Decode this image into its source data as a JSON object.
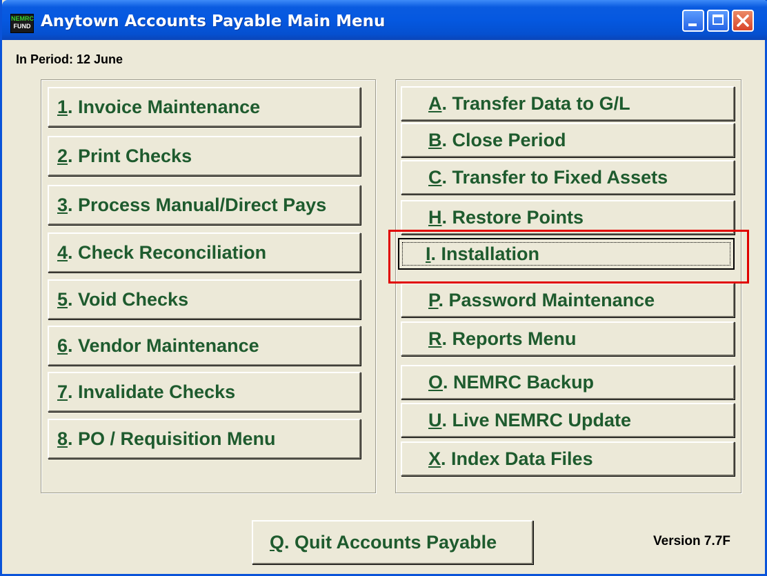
{
  "window": {
    "title": "Anytown Accounts Payable  Main Menu",
    "icon_text_top": "NEMRC",
    "icon_text_bottom": "FUND"
  },
  "period_label": "In Period: 12 June",
  "left_menu": [
    {
      "key": "1",
      "rest": ".  Invoice Maintenance"
    },
    {
      "key": "2",
      "rest": ". Print Checks"
    },
    {
      "key": "3",
      "rest": ". Process Manual/Direct Pays"
    },
    {
      "key": "4",
      "rest": ". Check Reconciliation"
    },
    {
      "key": "5",
      "rest": ". Void Checks"
    },
    {
      "key": "6",
      "rest": ". Vendor Maintenance"
    },
    {
      "key": "7",
      "rest": ". Invalidate Checks"
    },
    {
      "key": "8",
      "rest": ". PO / Requisition Menu"
    }
  ],
  "right_menu": [
    {
      "key": "A",
      "rest": ". Transfer Data to G/L"
    },
    {
      "key": "B",
      "rest": ". Close Period"
    },
    {
      "key": "C",
      "rest": ". Transfer to Fixed Assets"
    },
    {
      "key": "H",
      "rest": ". Restore Points"
    },
    {
      "key": "I",
      "rest": ".  Installation"
    },
    {
      "key": "P",
      "rest": ".  Password Maintenance"
    },
    {
      "key": "R",
      "rest": ".  Reports Menu"
    },
    {
      "key": "O",
      "rest": ". NEMRC Backup"
    },
    {
      "key": "U",
      "rest": ". Live NEMRC Update"
    },
    {
      "key": "X",
      "rest": ".  Index Data Files"
    }
  ],
  "quit": {
    "key": "Q",
    "rest": ". Quit Accounts Payable"
  },
  "version": "Version 7.7F",
  "colors": {
    "button_text": "#1E5B2E",
    "titlebar": "#0558E0",
    "highlight": "#E00000",
    "face": "#ECE9D8"
  }
}
